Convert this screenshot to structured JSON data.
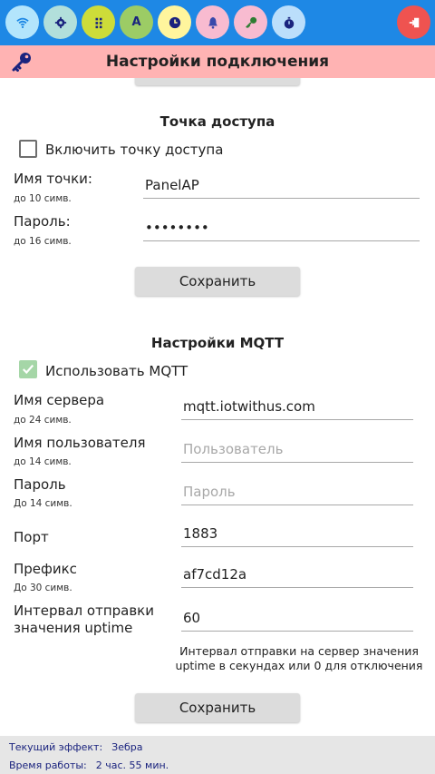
{
  "toolbar": {
    "buttons": [
      {
        "icon": "wifi-icon",
        "color": "#b3e5fc",
        "fg": "#1e88e5"
      },
      {
        "icon": "gear-icon",
        "color": "#b2dfdb",
        "fg": "#1a237e"
      },
      {
        "icon": "grid-icon",
        "color": "#cddc39",
        "fg": "#1a237e"
      },
      {
        "icon": "font-icon",
        "color": "#9ccc65",
        "fg": "#1a237e",
        "glyph": "A"
      },
      {
        "icon": "clock-icon",
        "color": "#fff59d",
        "fg": "#1a237e"
      },
      {
        "icon": "bell-icon",
        "color": "#f8bbd0",
        "fg": "#3949ab"
      },
      {
        "icon": "key-icon",
        "color": "#f8bbd0",
        "fg": "#2e7d32"
      },
      {
        "icon": "stopwatch-icon",
        "color": "#bbdefb",
        "fg": "#1a237e"
      }
    ],
    "exit_icon": "exit-icon",
    "exit_color": "#ef5350"
  },
  "header": {
    "title": "Настройки подключения",
    "icon": "key-icon"
  },
  "ap": {
    "title": "Точка доступа",
    "enable_label": "Включить точку доступа",
    "enabled": false,
    "name_label": "Имя точки:",
    "name_hint": "до 10 симв.",
    "name_value": "PanelAP",
    "password_label": "Пароль:",
    "password_hint": "до 16 симв.",
    "password_value": "••••••••",
    "save_label": "Сохранить"
  },
  "mqtt": {
    "title": "Настройки MQTT",
    "use_label": "Использовать MQTT",
    "enabled": true,
    "server_label": "Имя сервера",
    "server_hint": "до 24 симв.",
    "server_value": "mqtt.iotwithus.com",
    "user_label": "Имя пользователя",
    "user_hint": "до 14 симв.",
    "user_placeholder": "Пользователь",
    "pass_label": "Пароль",
    "pass_hint": "До 14 симв.",
    "pass_placeholder": "Пароль",
    "port_label": "Порт",
    "port_value": "1883",
    "prefix_label": "Префикс",
    "prefix_hint": "До 30 симв.",
    "prefix_value": "af7cd12a",
    "uptime_label_1": "Интервал отправки",
    "uptime_label_2": "значения uptime",
    "uptime_value": "60",
    "uptime_note_1": "Интервал отправки на сервер значения",
    "uptime_note_2": "uptime в секундах или 0 для отключения",
    "save_label": "Сохранить"
  },
  "footer": {
    "effect_label": "Текущий эффект:",
    "effect_value": "Зебра",
    "uptime_label": "Время работы:",
    "uptime_value": "2 час. 55 мин."
  }
}
